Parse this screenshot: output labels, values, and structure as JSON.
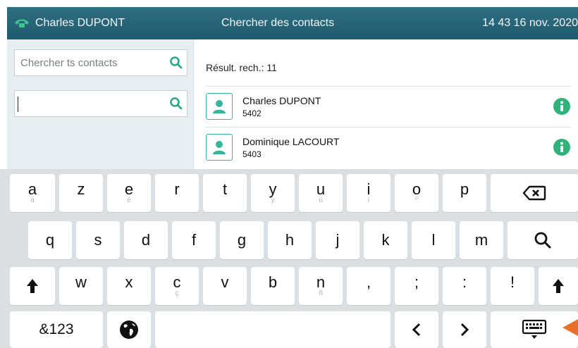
{
  "header": {
    "user_name": "Charles DUPONT",
    "title": "Chercher des contacts",
    "clock": "14 43  16 nov. 2020"
  },
  "left_panel": {
    "search_all_placeholder": "Chercher ts contacts",
    "search_local_value": ""
  },
  "results": {
    "count_label": "Résult. rech.: 11",
    "contacts": [
      {
        "name": "Charles DUPONT",
        "number": "5402"
      },
      {
        "name": "Dominique LACOURT",
        "number": "5403"
      }
    ]
  },
  "keyboard": {
    "row1": [
      {
        "main": "a",
        "alt": "à"
      },
      {
        "main": "z",
        "alt": ""
      },
      {
        "main": "e",
        "alt": "é"
      },
      {
        "main": "r",
        "alt": ""
      },
      {
        "main": "t",
        "alt": ""
      },
      {
        "main": "y",
        "alt": "ÿ"
      },
      {
        "main": "u",
        "alt": "ü"
      },
      {
        "main": "i",
        "alt": "ï"
      },
      {
        "main": "o",
        "alt": "º"
      },
      {
        "main": "p",
        "alt": ""
      }
    ],
    "row2": [
      "q",
      "s",
      "d",
      "f",
      "g",
      "h",
      "j",
      "k",
      "l",
      "m"
    ],
    "row3": [
      {
        "main": "w",
        "alt": ""
      },
      {
        "main": "x",
        "alt": ""
      },
      {
        "main": "c",
        "alt": "ç"
      },
      {
        "main": "v",
        "alt": ""
      },
      {
        "main": "b",
        "alt": ""
      },
      {
        "main": "n",
        "alt": "ñ"
      },
      {
        "main": ",",
        "alt": ""
      },
      {
        "main": ";",
        "alt": ""
      },
      {
        "main": ":",
        "alt": ""
      },
      {
        "main": "!",
        "alt": ""
      }
    ],
    "symbols_label": "&123",
    "icons": {
      "backspace": "backspace-icon",
      "search": "search-icon",
      "shift": "shift-arrow-icon",
      "globe": "globe-icon",
      "left": "chevron-left-icon",
      "right": "chevron-right-icon",
      "hide_keyboard": "keyboard-hide-icon"
    }
  },
  "colors": {
    "header_bg": "#2a6a7d",
    "accent_teal": "#35b59a",
    "info_green": "#2fb37a",
    "keyboard_bg": "#dcdfe1",
    "pointer_orange": "#e8702a"
  }
}
